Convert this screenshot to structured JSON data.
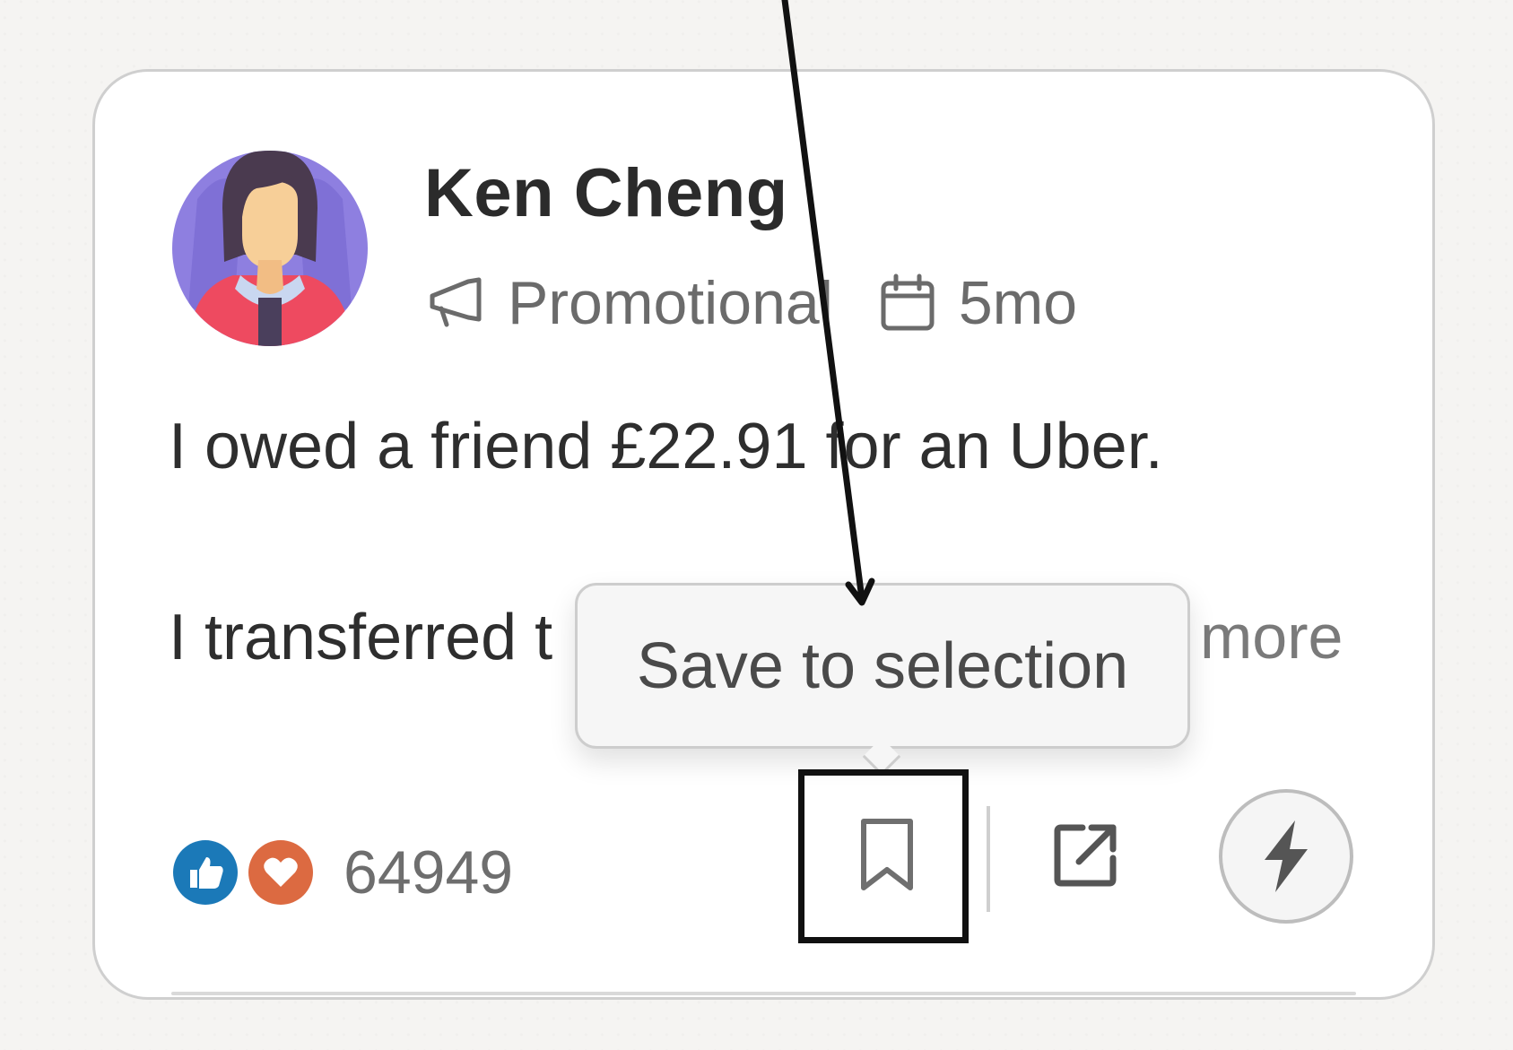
{
  "post": {
    "author_name": "Ken Cheng",
    "category": "Promotional",
    "category_icon": "megaphone-icon",
    "age": "5mo",
    "age_icon": "calendar-icon",
    "text_line_1": "I owed a friend £22.91 for an Uber.",
    "text_line_2": "I transferred t",
    "more_label": "more",
    "reaction_count": "64949",
    "reaction_icons": [
      "thumbs-up-icon",
      "heart-icon"
    ]
  },
  "actions": {
    "save_icon": "bookmark-icon",
    "share_icon": "external-share-icon",
    "boost_icon": "lightning-icon"
  },
  "tooltip": {
    "text": "Save to selection"
  },
  "colors": {
    "like_badge": "#1b79b8",
    "love_badge": "#dc6a41",
    "annotation": "#111111"
  }
}
